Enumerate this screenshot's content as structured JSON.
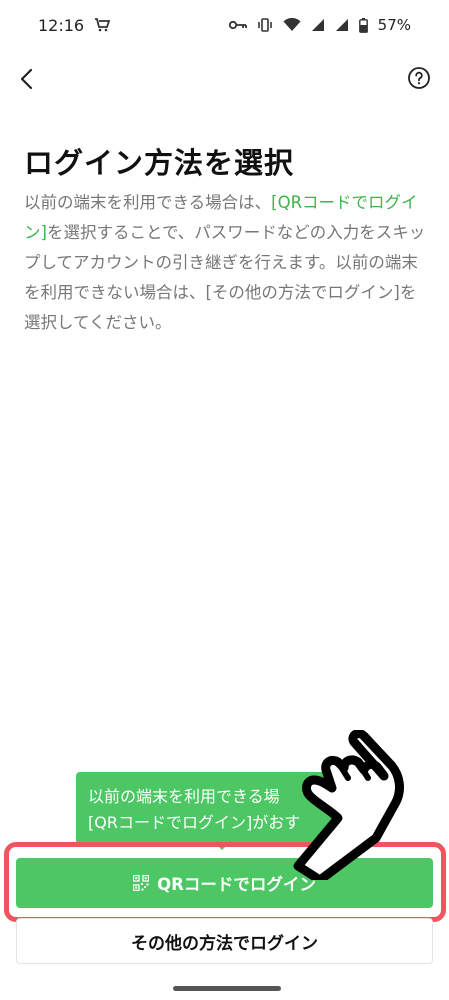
{
  "status_bar": {
    "time": "12:16",
    "battery": "57%",
    "icons": [
      "cart-icon",
      "key-icon",
      "vibrate-icon",
      "wifi-icon",
      "signal-icon",
      "signal-icon",
      "battery-icon"
    ]
  },
  "nav": {
    "back_icon": "chevron-left-icon",
    "help_icon": "question-circle-icon"
  },
  "page": {
    "title": "ログイン方法を選択",
    "desc": {
      "part1": "以前の端末を利用できる場合は、",
      "link": "[QRコードでログイン]",
      "part2": "を選択することで、パスワードなどの入力をスキップしてアカウントの引き継ぎを行えます。以前の端末を利用できない場合は、[その他の方法でログイン]を選択してください。"
    }
  },
  "tooltip": {
    "line1": "以前の端末を利用できる場",
    "line2": "[QRコードでログイン]がおす"
  },
  "buttons": {
    "qr_login": "QRコードでログイン",
    "other_login": "その他の方法でログイン"
  },
  "colors": {
    "accent_green": "#4cc764",
    "link_green": "#3db54a",
    "highlight_red": "#f0555f"
  }
}
